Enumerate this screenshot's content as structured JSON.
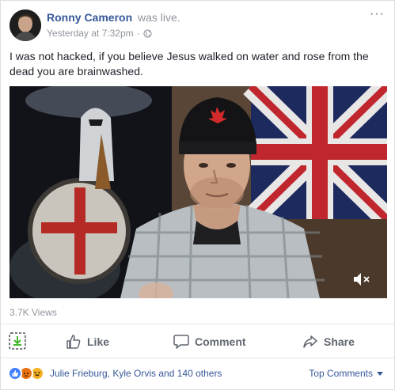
{
  "post": {
    "author": "Ronny Cameron",
    "author_status": "was live.",
    "timestamp": "Yesterday at 7:32pm",
    "separator": "·",
    "privacy_icon": "globe-icon",
    "text": "I was not hacked, if you believe Jesus walked on water and rose from the dead you are brainwashed."
  },
  "video": {
    "views": "3.7K Views",
    "mute_icon": "speaker-muted-icon"
  },
  "actions": {
    "like": "Like",
    "comment": "Comment",
    "share": "Share"
  },
  "reactions": {
    "icons": [
      "like",
      "angry",
      "haha"
    ],
    "summary": "Julie Frieburg, Kyle Orvis and 140 others",
    "sort_label": "Top Comments"
  },
  "colors": {
    "link_blue": "#365899",
    "meta_gray": "#90949c",
    "action_gray": "#606770",
    "like_blue": "#4080ff"
  }
}
